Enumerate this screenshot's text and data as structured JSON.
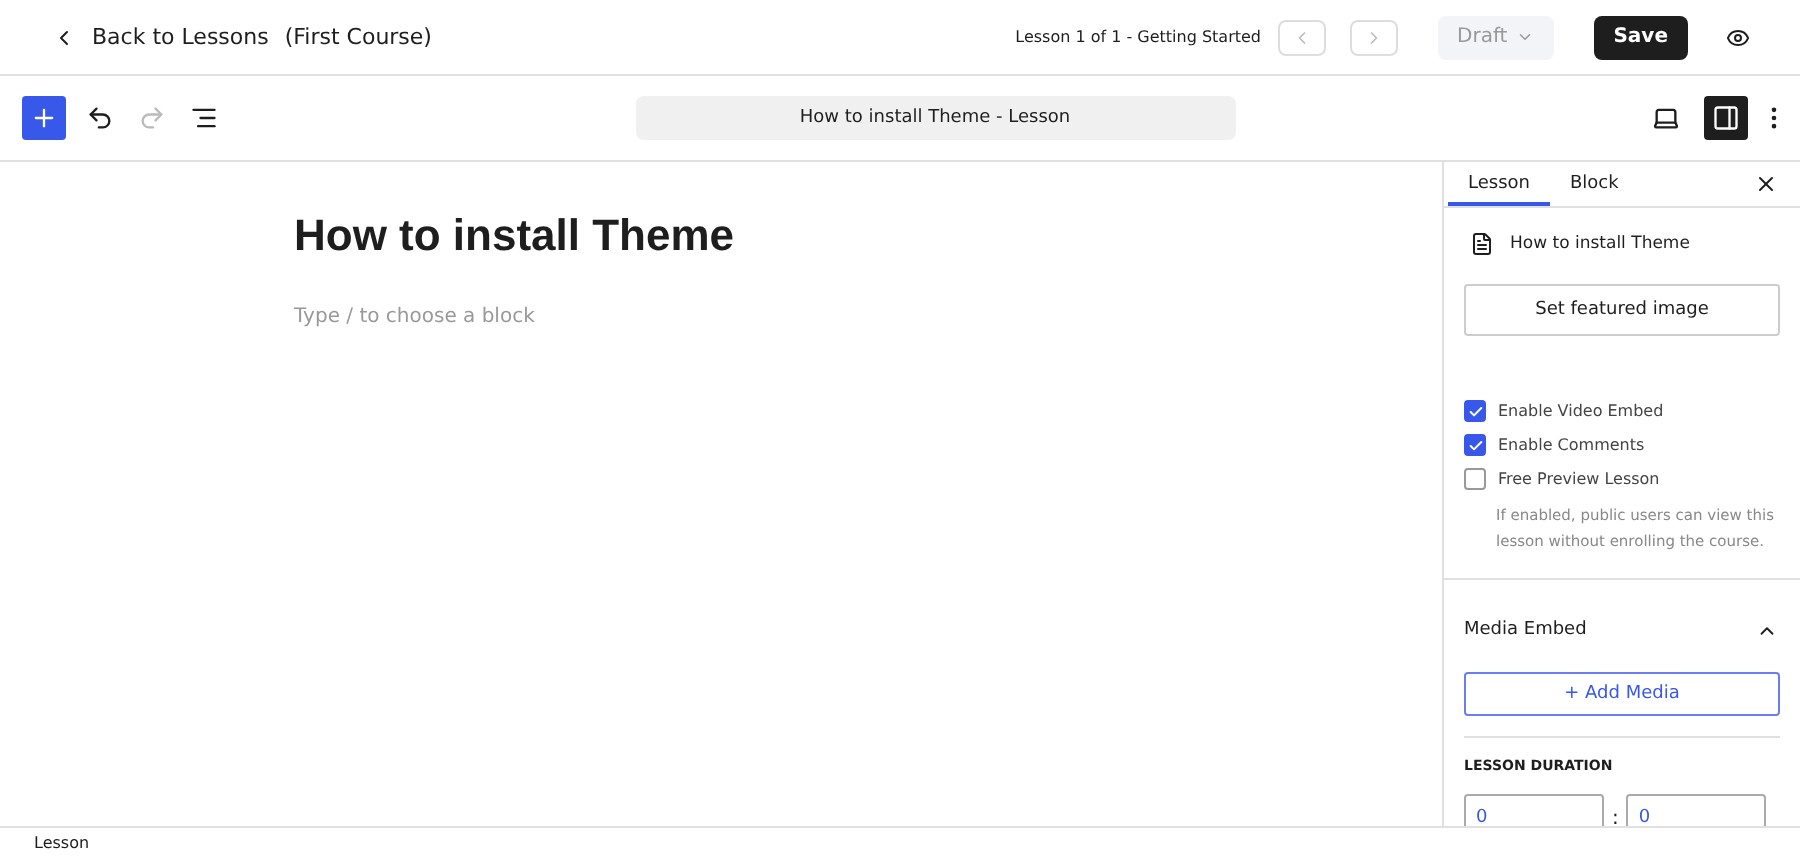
{
  "header": {
    "back": "Back to Lessons",
    "course": "(First Course)",
    "progress": "Lesson 1 of 1 - Getting Started",
    "status": "Draft",
    "save": "Save",
    "previous_disabled": true,
    "next_disabled": true
  },
  "toolbar": {
    "doc_title": "How to install Theme - Lesson",
    "sidebar_open": true,
    "redo_disabled": true
  },
  "editor": {
    "title": "How to install Theme",
    "placeholder": "Type / to choose a block"
  },
  "sidebar": {
    "tabs": [
      {
        "label": "Lesson",
        "selected": true
      },
      {
        "label": "Block",
        "selected": false
      }
    ],
    "post_title": "How to install Theme",
    "featured_button": "Set featured image",
    "options": [
      {
        "label": "Enable Video Embed",
        "checked": true
      },
      {
        "label": "Enable Comments",
        "checked": true
      },
      {
        "label": "Free Preview Lesson",
        "checked": false
      }
    ],
    "preview_help": "If enabled, public users can view this lesson without enrolling the course.",
    "media": {
      "title": "Media Embed",
      "expanded": true,
      "add_button": "+ Add Media"
    },
    "duration": {
      "label": "LESSON DURATION",
      "minutes": "0",
      "separator": ":",
      "seconds": "0"
    }
  },
  "status_bar": "Lesson"
}
